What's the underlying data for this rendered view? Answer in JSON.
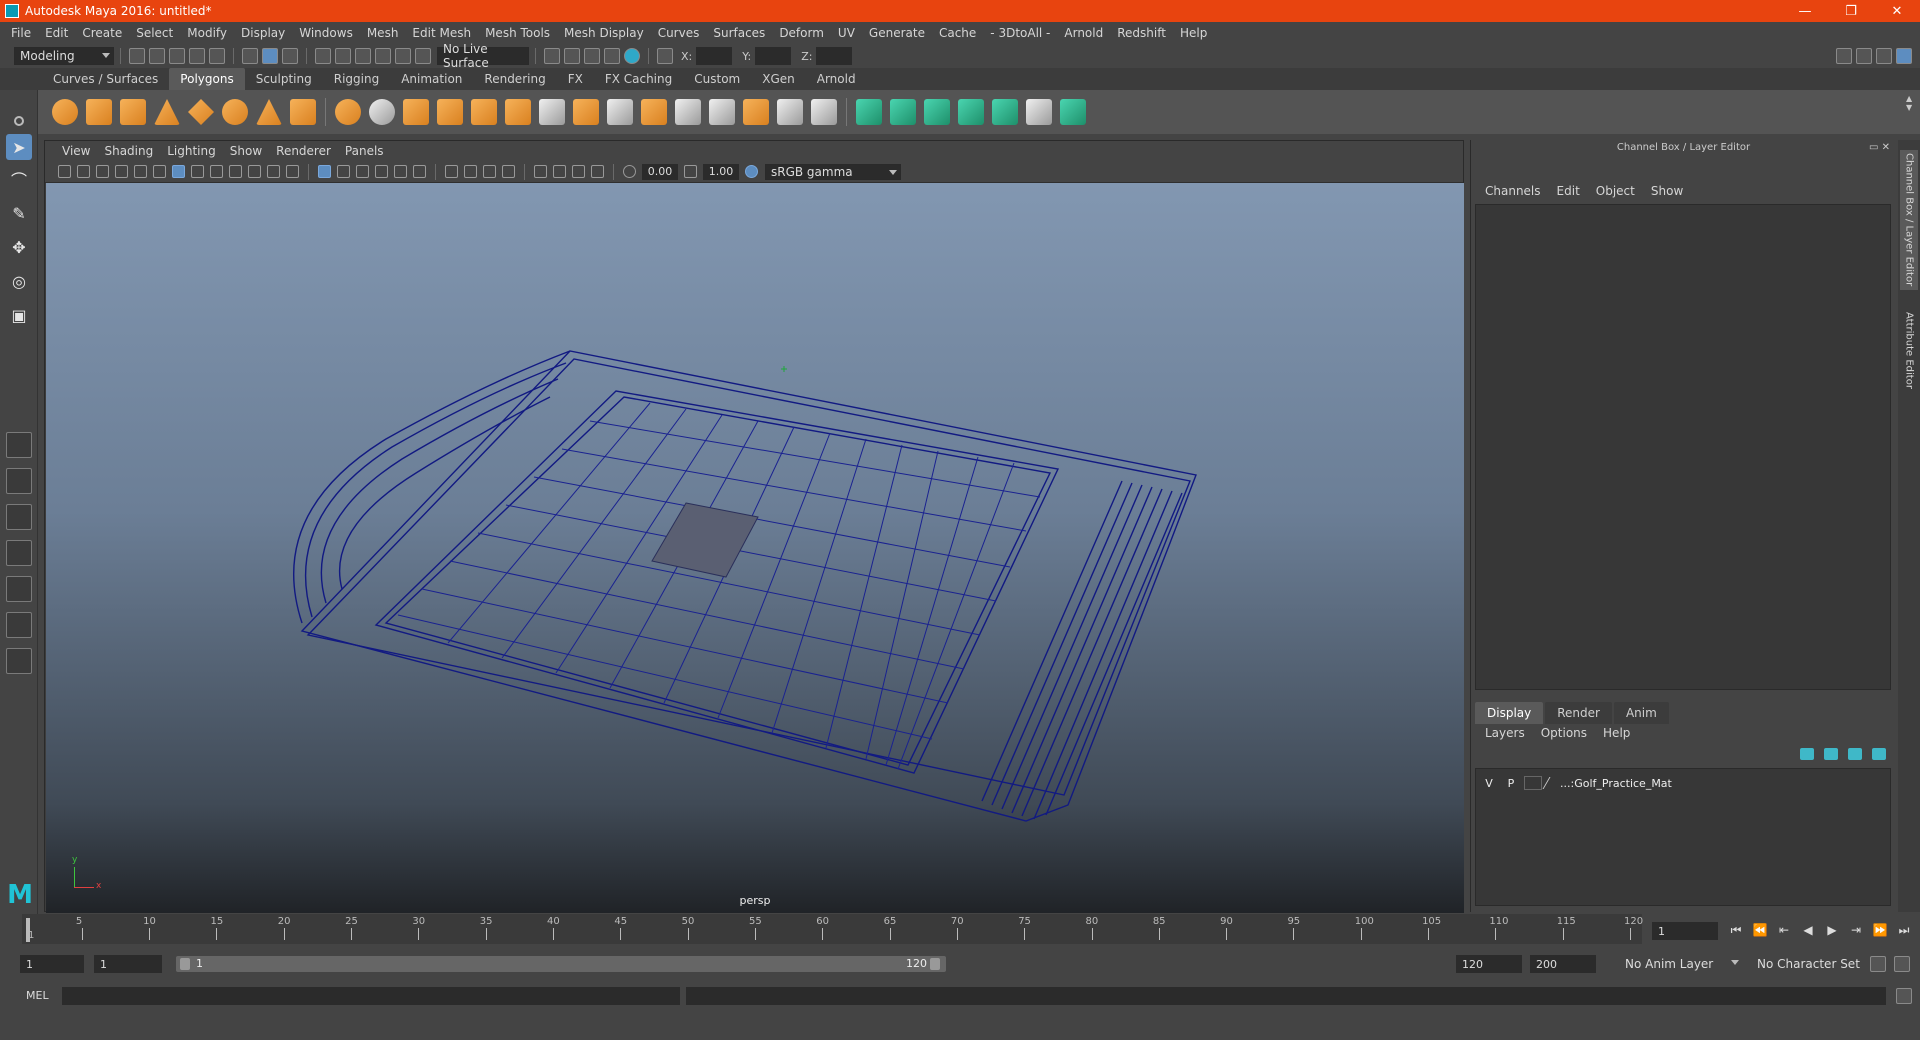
{
  "window": {
    "title": "Autodesk Maya 2016: untitled*",
    "controls": [
      "—",
      "❐",
      "✕"
    ]
  },
  "menubar": [
    "File",
    "Edit",
    "Create",
    "Select",
    "Modify",
    "Display",
    "Windows",
    "Mesh",
    "Edit Mesh",
    "Mesh Tools",
    "Mesh Display",
    "Curves",
    "Surfaces",
    "Deform",
    "UV",
    "Generate",
    "Cache",
    "- 3DtoAll -",
    "Arnold",
    "Redshift",
    "Help"
  ],
  "statusline": {
    "mode": "Modeling",
    "live_surface": "No Live Surface",
    "x_label": "X:",
    "y_label": "Y:",
    "z_label": "Z:"
  },
  "shelf": {
    "tabs": [
      "Curves / Surfaces",
      "Polygons",
      "Sculpting",
      "Rigging",
      "Animation",
      "Rendering",
      "FX",
      "FX Caching",
      "Custom",
      "XGen",
      "Arnold"
    ],
    "active_tab": "Polygons"
  },
  "viewport": {
    "menus": [
      "View",
      "Shading",
      "Lighting",
      "Show",
      "Renderer",
      "Panels"
    ],
    "exposure": "0.00",
    "gamma": "1.00",
    "color_space": "sRGB gamma",
    "camera": "persp",
    "axis_x": "x",
    "axis_y": "y"
  },
  "channelbox": {
    "title": "Channel Box / Layer Editor",
    "menus": [
      "Channels",
      "Edit",
      "Object",
      "Show"
    ],
    "layer_tabs": [
      "Display",
      "Render",
      "Anim"
    ],
    "active_layer_tab": "Display",
    "layer_menus": [
      "Layers",
      "Options",
      "Help"
    ],
    "layer": {
      "visible": "V",
      "playback": "P",
      "name": "...:Golf_Practice_Mat"
    }
  },
  "sidetabs": [
    "Channel Box / Layer Editor",
    "Attribute Editor"
  ],
  "timeline": {
    "ticks": [
      5,
      10,
      15,
      20,
      25,
      30,
      35,
      40,
      45,
      50,
      55,
      60,
      65,
      70,
      75,
      80,
      85,
      90,
      95,
      100,
      105,
      110,
      115,
      120
    ],
    "start_label": "1",
    "current_frame": "1"
  },
  "range": {
    "start": "1",
    "playback_start": "1",
    "slider_start": "1",
    "slider_end": "120",
    "playback_end": "120",
    "end": "200",
    "anim_layer": "No Anim Layer",
    "character_set": "No Character Set"
  },
  "cmdline": {
    "label": "MEL"
  }
}
